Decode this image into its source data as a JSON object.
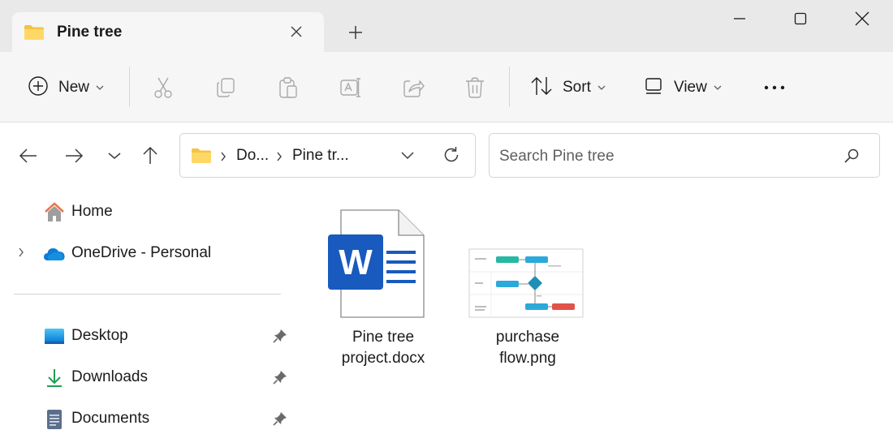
{
  "tab": {
    "title": "Pine tree",
    "close_icon": "close-icon",
    "new_tab_icon": "plus-icon"
  },
  "window": {
    "minimize_icon": "minimize-icon",
    "maximize_icon": "maximize-icon",
    "close_icon": "close-icon"
  },
  "toolbar": {
    "new_label": "New",
    "sort_label": "Sort",
    "view_label": "View",
    "icons": [
      "cut-icon",
      "copy-icon",
      "paste-icon",
      "rename-icon",
      "share-icon",
      "delete-icon",
      "more-icon"
    ]
  },
  "address": {
    "crumbs": [
      "Do...",
      "Pine tr..."
    ],
    "back_icon": "back-arrow-icon",
    "forward_icon": "forward-arrow-icon",
    "recent_icon": "chevron-down-icon",
    "up_icon": "up-arrow-icon"
  },
  "search": {
    "placeholder": "Search Pine tree"
  },
  "sidebar": {
    "items": [
      {
        "label": "Home",
        "icon": "home-icon"
      },
      {
        "label": "OneDrive - Personal",
        "icon": "onedrive-cloud-icon"
      },
      {
        "label": "Desktop",
        "icon": "desktop-icon",
        "pinned": true
      },
      {
        "label": "Downloads",
        "icon": "download-icon",
        "pinned": true
      },
      {
        "label": "Documents",
        "icon": "documents-icon",
        "pinned": true
      }
    ]
  },
  "files": [
    {
      "name": "Pine tree\nproject.docx",
      "icon": "word-document-icon"
    },
    {
      "name": "purchase\nflow.png",
      "icon": "flowchart-image-thumbnail"
    }
  ],
  "colors": {
    "accent": "#0067c0",
    "folder": "#f5c344",
    "word": "#185abd",
    "titlebar": "#e9e9e9",
    "commandbar": "#f6f6f6"
  }
}
